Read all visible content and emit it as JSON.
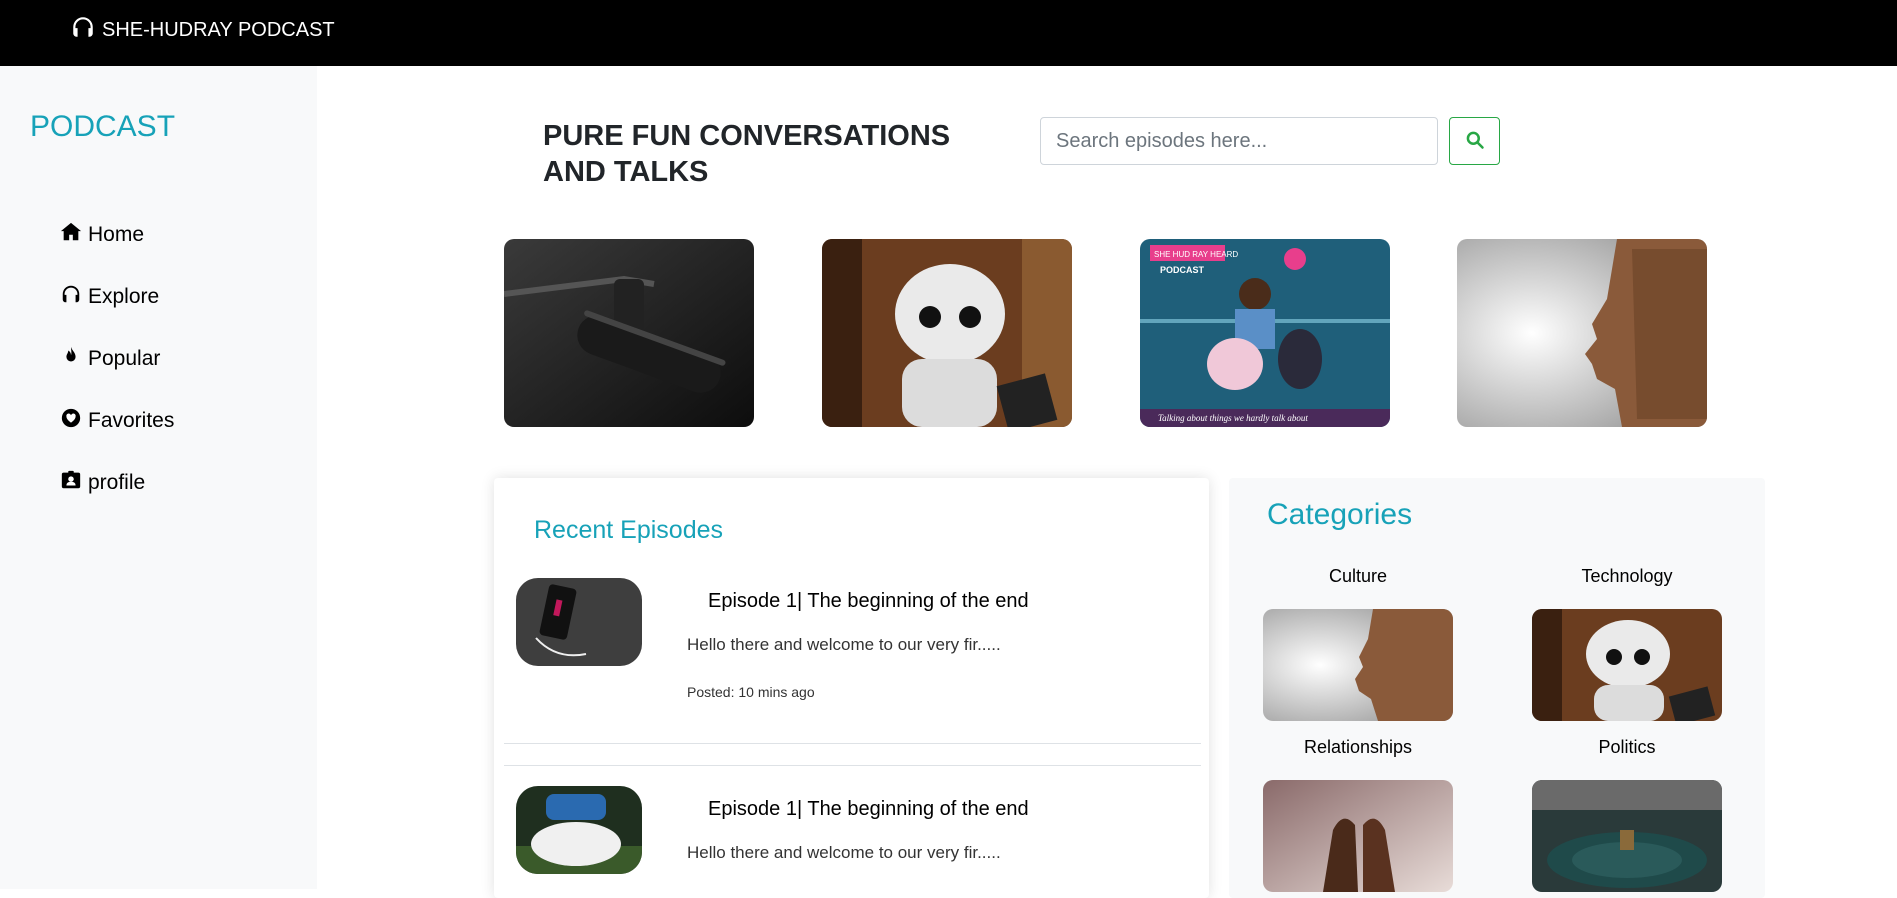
{
  "navbar": {
    "brand": "SHE-HUDRAY PODCAST",
    "brand_icon": "headphones-icon"
  },
  "sidebar": {
    "title": "PODCAST",
    "items": [
      {
        "label": "Home",
        "icon": "home-icon"
      },
      {
        "label": "Explore",
        "icon": "headphones-icon"
      },
      {
        "label": "Popular",
        "icon": "fire-icon"
      },
      {
        "label": "Favorites",
        "icon": "heart-icon"
      },
      {
        "label": "profile",
        "icon": "id-badge-icon"
      }
    ]
  },
  "header": {
    "headline": "PURE FUN CONVERSATIONS AND TALKS"
  },
  "search": {
    "placeholder": "Search episodes here...",
    "button_icon": "search-icon"
  },
  "featured": [
    {
      "name": "microphone-image"
    },
    {
      "name": "robot-image"
    },
    {
      "name": "podcast-cover-image",
      "badge": "SHE HUD RAY HEARD",
      "title": "PODCAST",
      "caption": "Talking about things we hardly talk about"
    },
    {
      "name": "faces-silhouette-image"
    }
  ],
  "recent": {
    "title": "Recent Episodes",
    "episodes": [
      {
        "title": "Episode 1| The beginning of the end",
        "description": "Hello there and welcome to our very fir.....",
        "posted": "Posted: 10 mins ago"
      },
      {
        "title": "Episode 1| The beginning of the end",
        "description": "Hello there and welcome to our very fir....."
      }
    ]
  },
  "categories": {
    "title": "Categories",
    "items": [
      {
        "label": "Culture"
      },
      {
        "label": "Technology"
      },
      {
        "label": "Relationships"
      },
      {
        "label": "Politics"
      }
    ]
  },
  "colors": {
    "accent": "#17a2b8",
    "search_green": "#28a745",
    "navbar": "#000000",
    "sidebar_bg": "#f8f9fa"
  }
}
